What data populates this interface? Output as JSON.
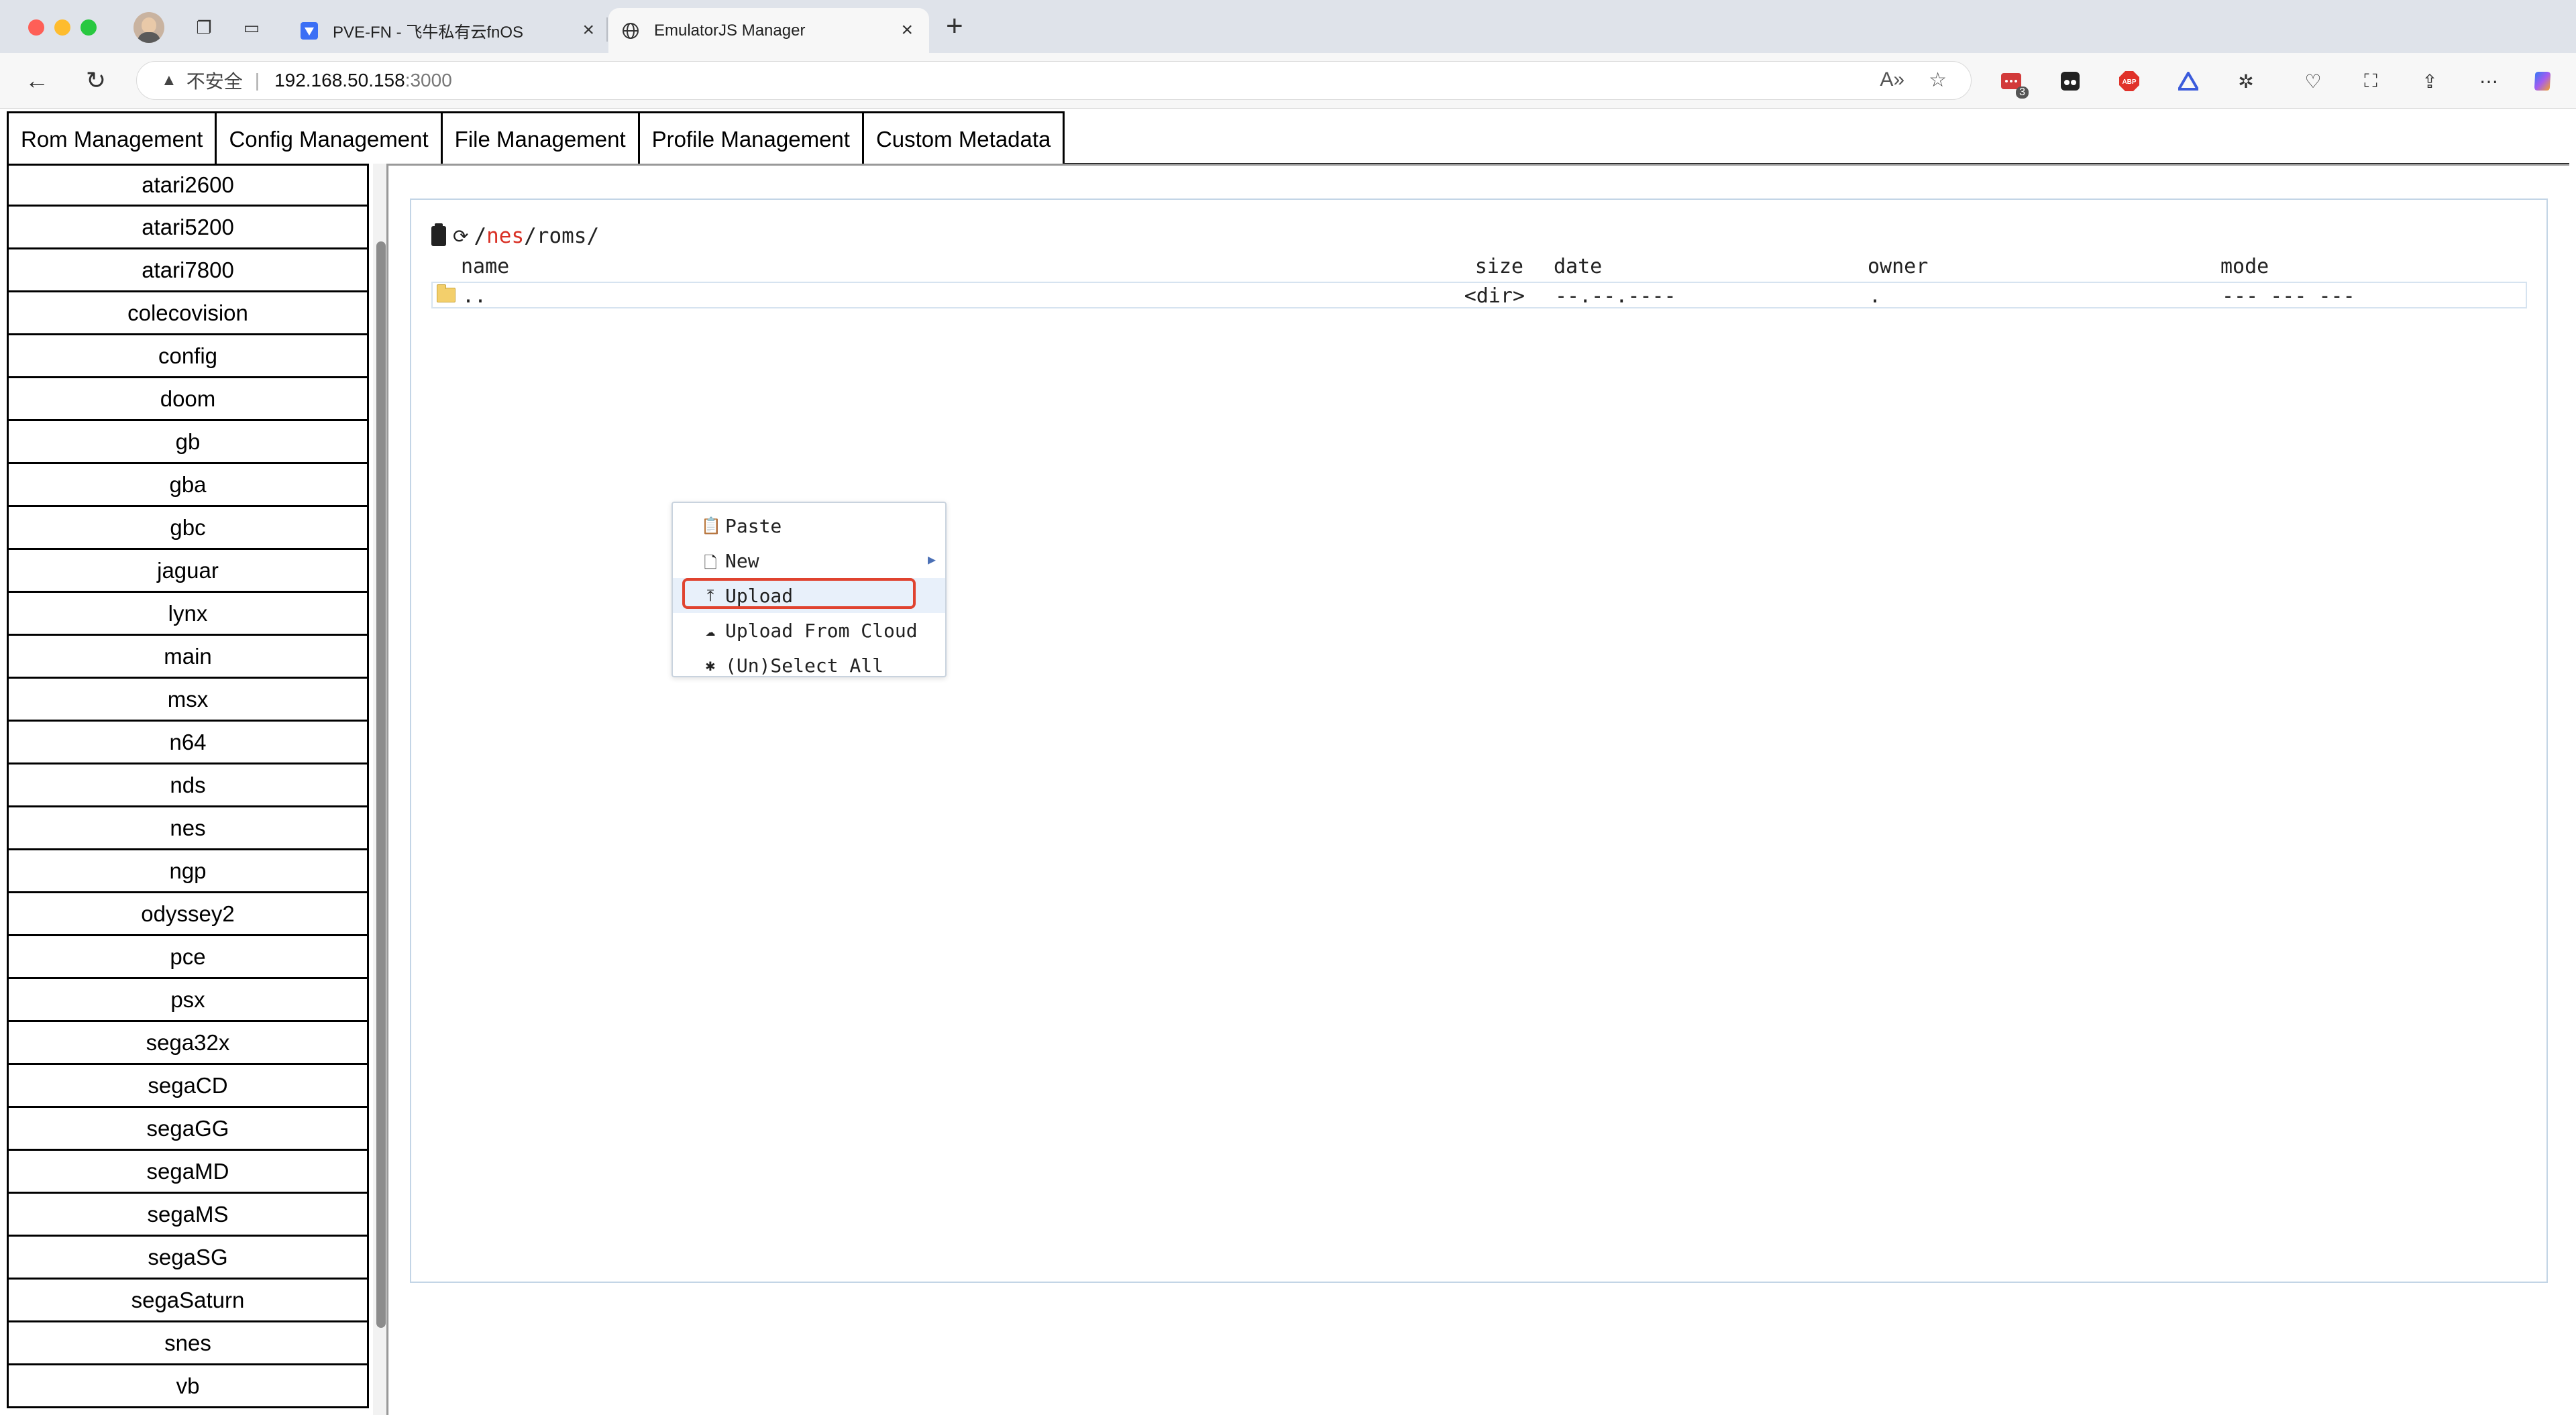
{
  "browser": {
    "tabs": [
      {
        "title": "PVE-FN - 飞牛私有云fnOS",
        "active": false
      },
      {
        "title": "EmulatorJS Manager",
        "active": true
      }
    ],
    "address": {
      "security_label": "不安全",
      "host": "192.168.50.158",
      "port": ":3000"
    },
    "extension_badge": "3"
  },
  "topnav": {
    "items": [
      "Rom Management",
      "Config Management",
      "File Management",
      "Profile Management",
      "Custom Metadata"
    ]
  },
  "sidebar": {
    "items": [
      "atari2600",
      "atari5200",
      "atari7800",
      "colecovision",
      "config",
      "doom",
      "gb",
      "gba",
      "gbc",
      "jaguar",
      "lynx",
      "main",
      "msx",
      "n64",
      "nds",
      "nes",
      "ngp",
      "odyssey2",
      "pce",
      "psx",
      "sega32x",
      "segaCD",
      "segaGG",
      "segaMD",
      "segaMS",
      "segaSG",
      "segaSaturn",
      "snes",
      "vb"
    ]
  },
  "file_manager": {
    "path_root": "/",
    "path_active": "nes",
    "path_rest": "/roms/",
    "columns": {
      "name": "name",
      "size": "size",
      "date": "date",
      "owner": "owner",
      "mode": "mode"
    },
    "rows": [
      {
        "name": "..",
        "size": "<dir>",
        "date": "--.--.----",
        "owner": ".",
        "mode": "--- --- ---"
      }
    ]
  },
  "context_menu": {
    "items": [
      {
        "label": "Paste",
        "icon": "paste-icon"
      },
      {
        "label": "New",
        "icon": "new-file-icon",
        "submenu": true
      },
      {
        "label": "Upload",
        "icon": "upload-icon",
        "highlighted": true
      },
      {
        "label": "Upload From Cloud",
        "icon": "cloud-upload-icon"
      },
      {
        "label": "(Un)Select All",
        "icon": "asterisk-icon"
      }
    ],
    "highlight_color": "#e0432f"
  }
}
